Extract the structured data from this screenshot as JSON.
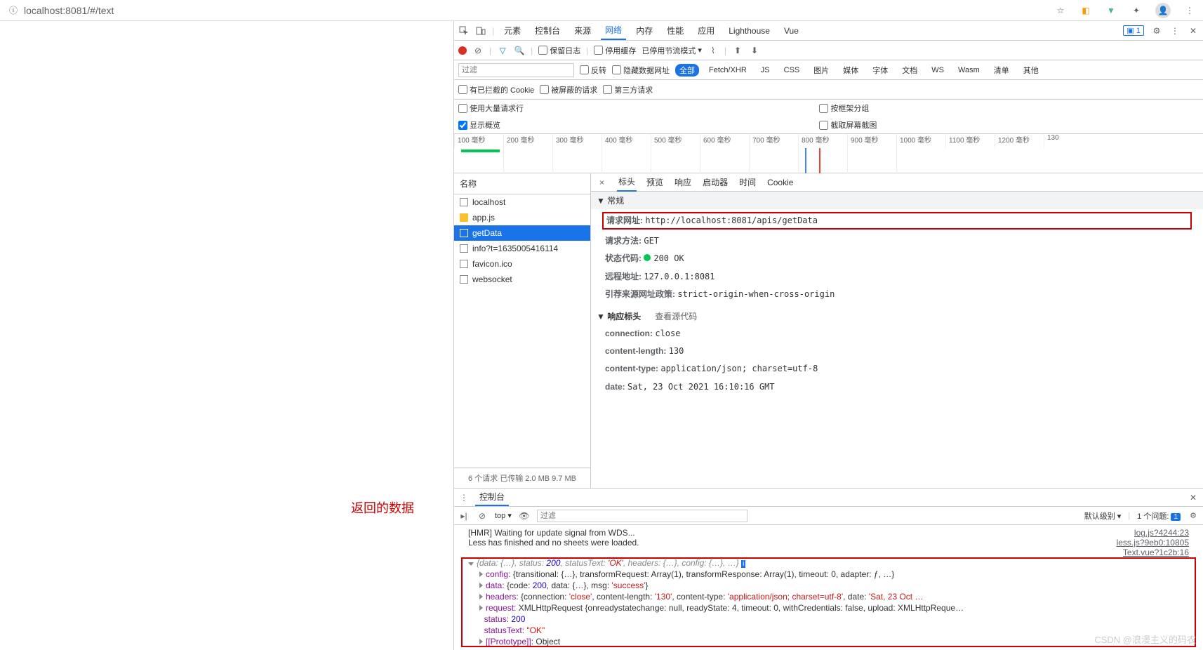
{
  "browser": {
    "url": "localhost:8081/#/text"
  },
  "devtools": {
    "tabs": [
      "元素",
      "控制台",
      "来源",
      "网络",
      "内存",
      "性能",
      "应用",
      "Lighthouse",
      "Vue"
    ],
    "active_tab": "网络",
    "msg_count": "1",
    "toolbar": {
      "preserve_log": "保留日志",
      "disable_cache": "停用缓存",
      "throttle": "已停用节流模式"
    },
    "filter_row": {
      "filter_placeholder": "过滤",
      "invert": "反转",
      "hide_data": "隐藏数据网址",
      "types": [
        "全部",
        "Fetch/XHR",
        "JS",
        "CSS",
        "图片",
        "媒体",
        "字体",
        "文档",
        "WS",
        "Wasm",
        "清单",
        "其他"
      ]
    },
    "cookie_row": {
      "blocked_cookie": "有已拦截的 Cookie",
      "blocked_req": "被屏蔽的请求",
      "third_party": "第三方请求"
    },
    "settings_row": {
      "big_rows": "使用大量请求行",
      "group_frame": "按框架分组",
      "show_overview": "显示概览",
      "screenshot": "截取屏幕截图"
    },
    "waterfall_ticks": [
      "100 毫秒",
      "200 毫秒",
      "300 毫秒",
      "400 毫秒",
      "500 毫秒",
      "600 毫秒",
      "700 毫秒",
      "800 毫秒",
      "900 毫秒",
      "1000 毫秒",
      "1100 毫秒",
      "1200 毫秒",
      "130"
    ]
  },
  "requests": {
    "header": "名称",
    "items": [
      "localhost",
      "app.js",
      "getData",
      "info?t=1635005416114",
      "favicon.ico",
      "websocket"
    ],
    "selected": "getData",
    "footer": "6 个请求   已传输 2.0 MB   9.7 MB"
  },
  "detail": {
    "tabs": [
      "标头",
      "预览",
      "响应",
      "启动器",
      "时间",
      "Cookie"
    ],
    "active": "标头",
    "general_hdr": "常规",
    "url_label": "请求网址:",
    "url_value": "http://localhost:8081/apis/getData",
    "method_label": "请求方法:",
    "method_value": "GET",
    "status_label": "状态代码:",
    "status_value": "200 OK",
    "remote_label": "远程地址:",
    "remote_value": "127.0.0.1:8081",
    "referrer_label": "引荐来源网址政策:",
    "referrer_value": "strict-origin-when-cross-origin",
    "resp_hdr": "响应标头",
    "view_src": "查看源代码",
    "headers": {
      "connection_k": "connection:",
      "connection_v": "close",
      "contentlen_k": "content-length:",
      "contentlen_v": "130",
      "contenttype_k": "content-type:",
      "contenttype_v": "application/json; charset=utf-8",
      "date_k": "date:",
      "date_v": "Sat, 23 Oct 2021 16:10:16 GMT"
    }
  },
  "console": {
    "tab": "控制台",
    "top": "top",
    "filter_placeholder": "过滤",
    "level": "默认级别",
    "issue_count": "1 个问题:",
    "badge": "1",
    "lines": {
      "l1": "[HMR] Waiting for update signal from WDS...",
      "l1_link": "log.js?4244:23",
      "l2": "Less has finished and no sheets were loaded.",
      "l2_link": "less.js?9eb0:10805",
      "l3_link": "Text.vue?1c2b:16"
    },
    "obj": {
      "summary_prefix": "{data: {…}, status: ",
      "summary_status": "200",
      "summary_mid": ", statusText: ",
      "summary_stxt": "'OK'",
      "summary_end": ", headers: {…}, config: {…}, …}",
      "config_k": "config:",
      "config_v": "{transitional: {…}, transformRequest: Array(1), transformResponse: Array(1), timeout: 0, adapter: ƒ, …}",
      "data_k": "data:",
      "data_v_pre": "{code: ",
      "data_code": "200",
      "data_mid": ", data: {…}, msg: ",
      "data_msg": "'success'",
      "data_end": "}",
      "headers_k": "headers:",
      "headers_conn": "'close'",
      "headers_len": "'130'",
      "headers_ct": "'application/json; charset=utf-8'",
      "headers_date": "'Sat, 23 Oct …",
      "request_k": "request:",
      "request_v": "XMLHttpRequest {onreadystatechange: null, readyState: 4, timeout: 0, withCredentials: false, upload: XMLHttpReque…",
      "status_k": "status:",
      "status_v": "200",
      "stxt_k": "statusText:",
      "stxt_v": "\"OK\"",
      "proto_k": "[[Prototype]]:",
      "proto_v": "Object"
    }
  },
  "annotation": "返回的数据",
  "watermark": "CSDN @浪漫主义的码农"
}
